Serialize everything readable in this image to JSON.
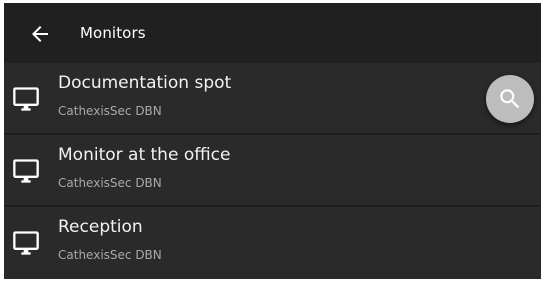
{
  "app_bar": {
    "title": "Monitors",
    "back_icon": "arrow-left-icon"
  },
  "monitors": [
    {
      "name": "Documentation spot",
      "server": "CathexisSec DBN",
      "icon": "monitor-icon"
    },
    {
      "name": "Monitor at the office",
      "server": "CathexisSec DBN",
      "icon": "monitor-icon"
    },
    {
      "name": "Reception",
      "server": "CathexisSec DBN",
      "icon": "monitor-icon"
    }
  ],
  "search_button": {
    "icon": "search-icon"
  },
  "colors": {
    "app_bar_bg": "#202020",
    "list_bg": "#2a2a2a",
    "divider": "#1e1e1e",
    "fab_bg": "#bdbdbd",
    "primary_text": "#f2f2f2",
    "secondary_text": "#a9a9a9"
  }
}
